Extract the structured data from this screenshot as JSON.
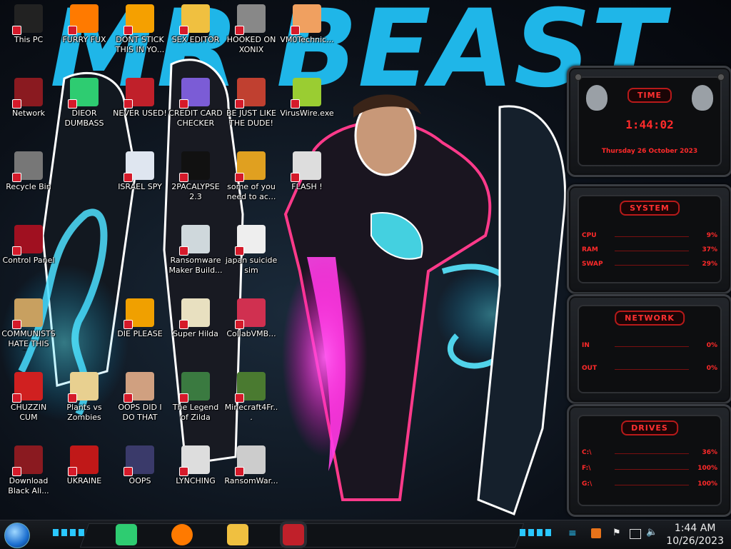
{
  "desktop": {
    "icons": [
      {
        "label": "This PC",
        "col": 0,
        "row": 0,
        "color": "#222"
      },
      {
        "label": "FURRY FUX",
        "col": 1,
        "row": 0,
        "color": "#ff7a00"
      },
      {
        "label": "DONT STICK THIS IN YO...",
        "col": 2,
        "row": 0,
        "color": "#f5a000"
      },
      {
        "label": "SEX EDITOR",
        "col": 3,
        "row": 0,
        "color": "#f0c040"
      },
      {
        "label": "HOOKED ON XONIX",
        "col": 4,
        "row": 0,
        "color": "#888"
      },
      {
        "label": "VM0Technic...",
        "col": 5,
        "row": 0,
        "color": "#f0a060"
      },
      {
        "label": "Network",
        "col": 0,
        "row": 1,
        "color": "#8a1a20"
      },
      {
        "label": "DIEOR DUMBASS",
        "col": 1,
        "row": 1,
        "color": "#2ecc71"
      },
      {
        "label": "NEVER USED!",
        "col": 2,
        "row": 1,
        "color": "#c0202a"
      },
      {
        "label": "CREDIT CARD CHECKER",
        "col": 3,
        "row": 1,
        "color": "#7b5cd6"
      },
      {
        "label": "BE JUST LIKE THE DUDE!",
        "col": 4,
        "row": 1,
        "color": "#c04030"
      },
      {
        "label": "VirusWire.exe",
        "col": 5,
        "row": 1,
        "color": "#9acd32"
      },
      {
        "label": "Recycle Bin",
        "col": 0,
        "row": 2,
        "color": "#777"
      },
      {
        "label": "ISRAEL SPY",
        "col": 2,
        "row": 2,
        "color": "#dfe6f0"
      },
      {
        "label": "2PACALYPSE 2.3",
        "col": 3,
        "row": 2,
        "color": "#111"
      },
      {
        "label": "some of you need to ac...",
        "col": 4,
        "row": 2,
        "color": "#e0a020"
      },
      {
        "label": "FLASH !",
        "col": 5,
        "row": 2,
        "color": "#ddd"
      },
      {
        "label": "Control Panel",
        "col": 0,
        "row": 3,
        "color": "#a01020"
      },
      {
        "label": "Ransomware Maker Build...",
        "col": 3,
        "row": 3,
        "color": "#cfd8dc"
      },
      {
        "label": "japan suicide sim",
        "col": 4,
        "row": 3,
        "color": "#eee"
      },
      {
        "label": "COMMUNISTS HATE THIS G...",
        "col": 0,
        "row": 4,
        "color": "#c8a060"
      },
      {
        "label": "DIE PLEASE",
        "col": 2,
        "row": 4,
        "color": "#f0a000"
      },
      {
        "label": "Super Hilda",
        "col": 3,
        "row": 4,
        "color": "#e8e0c0"
      },
      {
        "label": "CollabVMB...",
        "col": 4,
        "row": 4,
        "color": "#d03050"
      },
      {
        "label": "CHUZZIN CUM",
        "col": 0,
        "row": 5,
        "color": "#d02020"
      },
      {
        "label": "Plants vs Zombies",
        "col": 1,
        "row": 5,
        "color": "#e8d090"
      },
      {
        "label": "OOPS DID I DO THAT",
        "col": 2,
        "row": 5,
        "color": "#d0a080"
      },
      {
        "label": "The Legend of Zilda",
        "col": 3,
        "row": 5,
        "color": "#3a7a40"
      },
      {
        "label": "Minecraft4Fr...",
        "col": 4,
        "row": 5,
        "color": "#4a7a30"
      },
      {
        "label": "Download Black Ali...",
        "col": 0,
        "row": 6,
        "color": "#8a1a20"
      },
      {
        "label": "UKRAINE",
        "col": 1,
        "row": 6,
        "color": "#c01818"
      },
      {
        "label": "OOPS",
        "col": 2,
        "row": 6,
        "color": "#3a3a6a"
      },
      {
        "label": "LYNCHING",
        "col": 3,
        "row": 6,
        "color": "#ddd"
      },
      {
        "label": "RansomWar...",
        "col": 4,
        "row": 6,
        "color": "#ccc"
      }
    ]
  },
  "wallpaper": {
    "banner_text": "MR BEAST"
  },
  "widgets": {
    "time": {
      "title": "TIME",
      "clock": "1:44:02",
      "date": "Thursday 26 October 2023"
    },
    "system": {
      "title": "SYSTEM",
      "rows": [
        {
          "label": "CPU",
          "value": "9%"
        },
        {
          "label": "RAM",
          "value": "37%"
        },
        {
          "label": "SWAP",
          "value": "29%"
        }
      ]
    },
    "network": {
      "title": "NETWORK",
      "rows": [
        {
          "label": "IN",
          "value": "0%"
        },
        {
          "label": "OUT",
          "value": "0%"
        }
      ]
    },
    "drives": {
      "title": "DRIVES",
      "rows": [
        {
          "label": "C:\\",
          "value": "36%"
        },
        {
          "label": "F:\\",
          "value": "100%"
        },
        {
          "label": "G:\\",
          "value": "100%"
        }
      ]
    }
  },
  "taskbar": {
    "pinned": [
      {
        "name": "notes-app-icon",
        "color": "#2ecc71"
      },
      {
        "name": "firefox-icon",
        "color": "#ff7a00"
      },
      {
        "name": "file-explorer-icon",
        "color": "#f0c040"
      },
      {
        "name": "active-window-icon",
        "color": "#c0202a"
      }
    ],
    "clock_time": "1:44 AM",
    "clock_date": "10/26/2023"
  },
  "colors": {
    "accent": "#ff2a2a",
    "panel_border": "#b81a1a"
  }
}
